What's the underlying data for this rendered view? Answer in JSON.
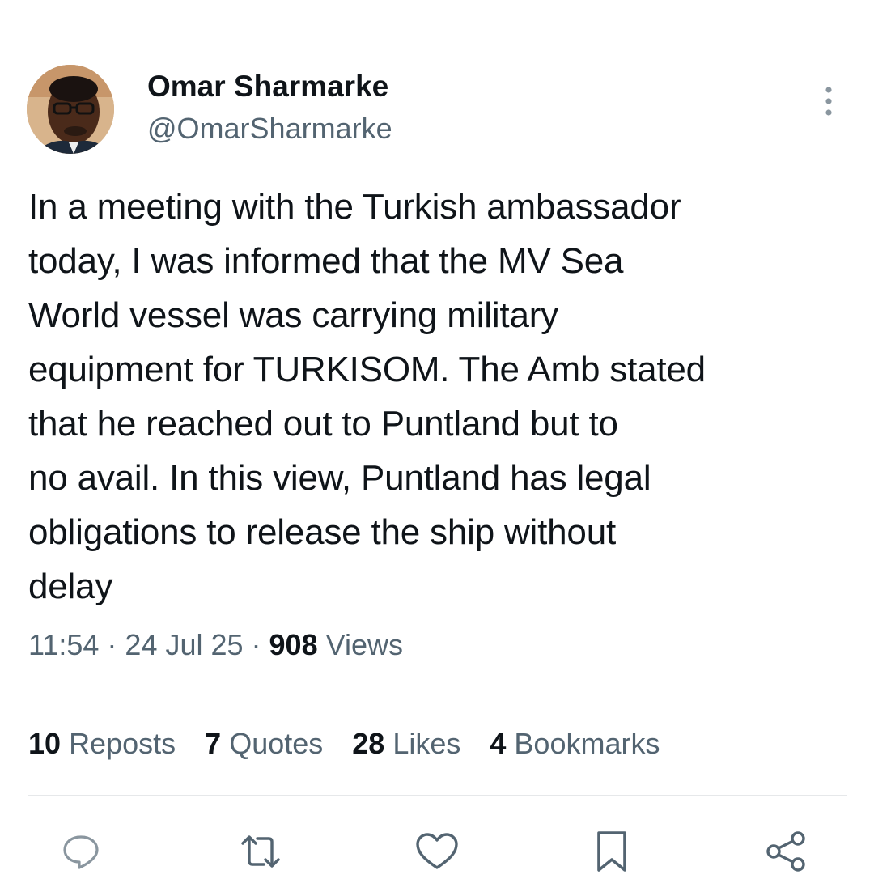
{
  "author": {
    "name": "Omar Sharmarke",
    "handle": "@OmarSharmarke"
  },
  "tweet": {
    "text": "In a meeting with the Turkish ambassador\ntoday, I was informed that the MV Sea\nWorld vessel was carrying military\nequipment for TURKISOM. The Amb stated\nthat he reached out to Puntland but to\nno avail. In this view, Puntland has legal\nobligations to release the ship without\ndelay",
    "time": "11:54",
    "date": "24 Jul 25",
    "views_count": "908",
    "views_label": "Views"
  },
  "stats": {
    "reposts_count": "10",
    "reposts_label": "Reposts",
    "quotes_count": "7",
    "quotes_label": "Quotes",
    "likes_count": "28",
    "likes_label": "Likes",
    "bookmarks_count": "4",
    "bookmarks_label": "Bookmarks"
  },
  "actions": {
    "icons": [
      "reply-icon",
      "repost-icon",
      "like-icon",
      "bookmark-icon",
      "share-icon"
    ]
  },
  "colors": {
    "text_primary": "#0f1419",
    "text_secondary": "#536471",
    "divider": "#e6e8ea"
  }
}
